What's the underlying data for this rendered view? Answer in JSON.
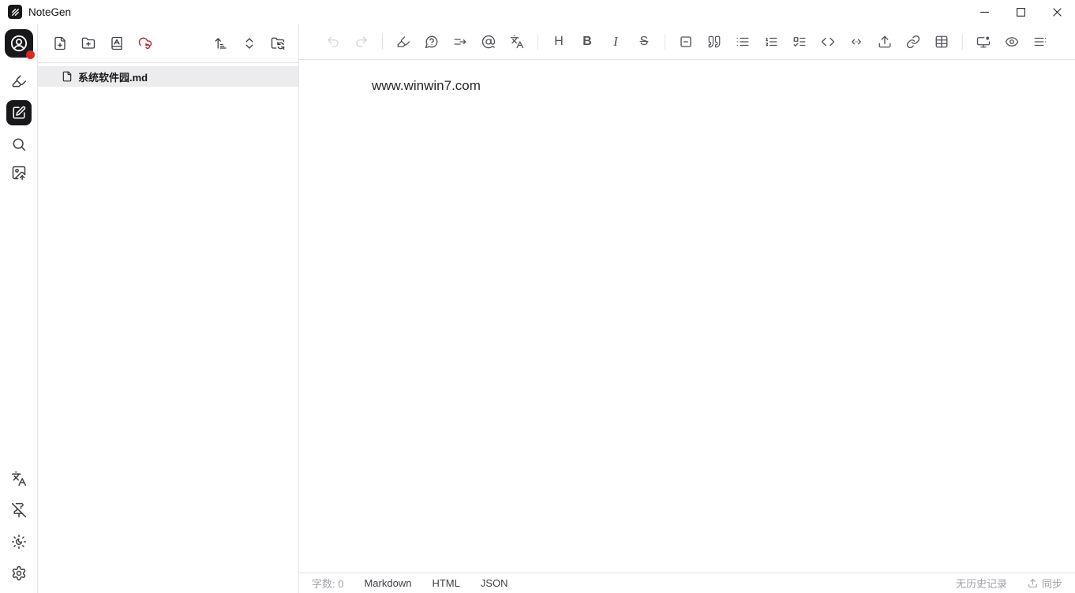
{
  "titlebar": {
    "app_name": "NoteGen"
  },
  "colors": {
    "accent_red": "#dc2626",
    "icon_gray": "#52525b",
    "icon_disabled": "#d4d4d8",
    "dark": "#18181b",
    "border": "#e4e4e7",
    "selection_bg": "#ececee"
  },
  "sidebar": {
    "icons_top": [
      "user-avatar",
      "record-pen",
      "write-edit-active",
      "search",
      "image-hosting"
    ],
    "icons_bottom": [
      "languages",
      "pin-off",
      "theme-sun-moon",
      "settings"
    ]
  },
  "file_panel": {
    "toolbar_icons_left": [
      "new-file",
      "new-folder",
      "sort-by-name-book",
      "cloud-sync-red"
    ],
    "toolbar_icons_right": [
      "sort-ascending",
      "chevrons-up-down",
      "folder-switch"
    ],
    "files": [
      {
        "name": "系统软件园.md",
        "selected": true
      }
    ]
  },
  "editor_toolbar": {
    "heading_label": "H",
    "bold_label": "B",
    "italic_label": "I",
    "strikethrough_label": "S",
    "icons": [
      "undo",
      "redo",
      "highlighter-pen",
      "ai-question-bubble",
      "continue-writing",
      "at-search",
      "translate",
      "heading",
      "bold",
      "italic",
      "strikethrough",
      "horizontal-rule",
      "blockquote",
      "bullet-list",
      "ordered-list",
      "task-list",
      "inline-code",
      "code-block",
      "export-upload",
      "link",
      "table",
      "presentation-monitor",
      "preview-eye",
      "outline"
    ]
  },
  "editor": {
    "content": "www.winwin7.com"
  },
  "status_bar": {
    "word_count": "字数: 0",
    "formats": [
      "Markdown",
      "HTML",
      "JSON"
    ],
    "history_label": "无历史记录",
    "sync_label": "同步"
  }
}
